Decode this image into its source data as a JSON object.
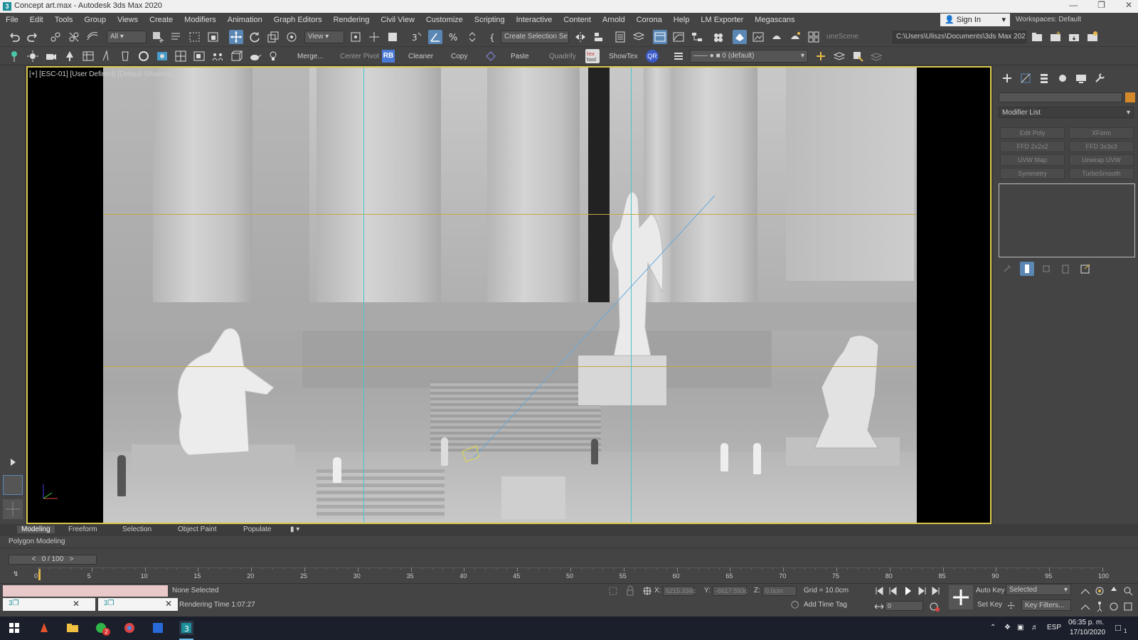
{
  "window": {
    "title": "Concept art.max - Autodesk 3ds Max 2020"
  },
  "menu": [
    "File",
    "Edit",
    "Tools",
    "Group",
    "Views",
    "Create",
    "Modifiers",
    "Animation",
    "Graph Editors",
    "Rendering",
    "Civil View",
    "Customize",
    "Scripting",
    "Interactive",
    "Content",
    "Arnold",
    "Corona",
    "Help",
    "LM Exporter",
    "Megascans"
  ],
  "account": {
    "signin": "Sign In",
    "workspaces_label": "Workspaces:",
    "workspace": "Default"
  },
  "toolbar": {
    "filter": "All",
    "ref_coord": "View",
    "selection_set": "Create Selection Se",
    "scene_explorer": "uneScene",
    "path": "C:\\Users\\Uliszs\\Documents\\3ds Max 2020"
  },
  "toolbar2": {
    "merge": "Merge...",
    "center_pivot": "Center Pivot",
    "rb": "RB",
    "cleaner": "Cleaner",
    "copy": "Copy",
    "paste": "Paste",
    "quadrify": "Quadrify",
    "showtex": "ShowTex",
    "qr": "QR",
    "layer": "0 (default)"
  },
  "viewport": {
    "label": "[+] [ESC-01] [User Defined] [Default Shading]"
  },
  "command_panel": {
    "modifier_list": "Modifier List",
    "buttons": [
      "Edit Poly",
      "XForm",
      "FFD 2x2x2",
      "FFD 3x3x3",
      "UVW Map",
      "Unwrap UVW",
      "Symmetry",
      "TurboSmooth"
    ]
  },
  "ribbon": {
    "tabs": [
      "Modeling",
      "Freeform",
      "Selection",
      "Object Paint",
      "Populate"
    ],
    "panel": "Polygon Modeling"
  },
  "timeline": {
    "frame": "0 / 100",
    "ticks": [
      "0",
      "5",
      "10",
      "15",
      "20",
      "25",
      "30",
      "35",
      "40",
      "45",
      "50",
      "55",
      "60",
      "65",
      "70",
      "75",
      "80",
      "85",
      "90",
      "95",
      "100"
    ]
  },
  "status": {
    "selection": "None Selected",
    "render_time": "Rendering Time 1:07:27",
    "x_label": "X:",
    "x": "6215.334c",
    "y_label": "Y:",
    "y": "-6617.593c",
    "z_label": "Z:",
    "z": "0.0cm",
    "grid": "Grid = 10.0cm",
    "add_time_tag": "Add Time Tag",
    "auto_key": "Auto Key",
    "set_key": "Set Key",
    "key_mode": "Selected",
    "key_filters": "Key Filters...",
    "current_frame": "0"
  },
  "taskbar": {
    "lang": "ESP",
    "time": "06:35 p. m.",
    "date": "17/10/2020",
    "badge": "2",
    "notif": "1"
  },
  "colors": {
    "accent": "#5b87b5",
    "viewport_border": "#d9c64a",
    "guide_cyan": "#4ac6c8",
    "guide_gold": "#c8a84a"
  }
}
